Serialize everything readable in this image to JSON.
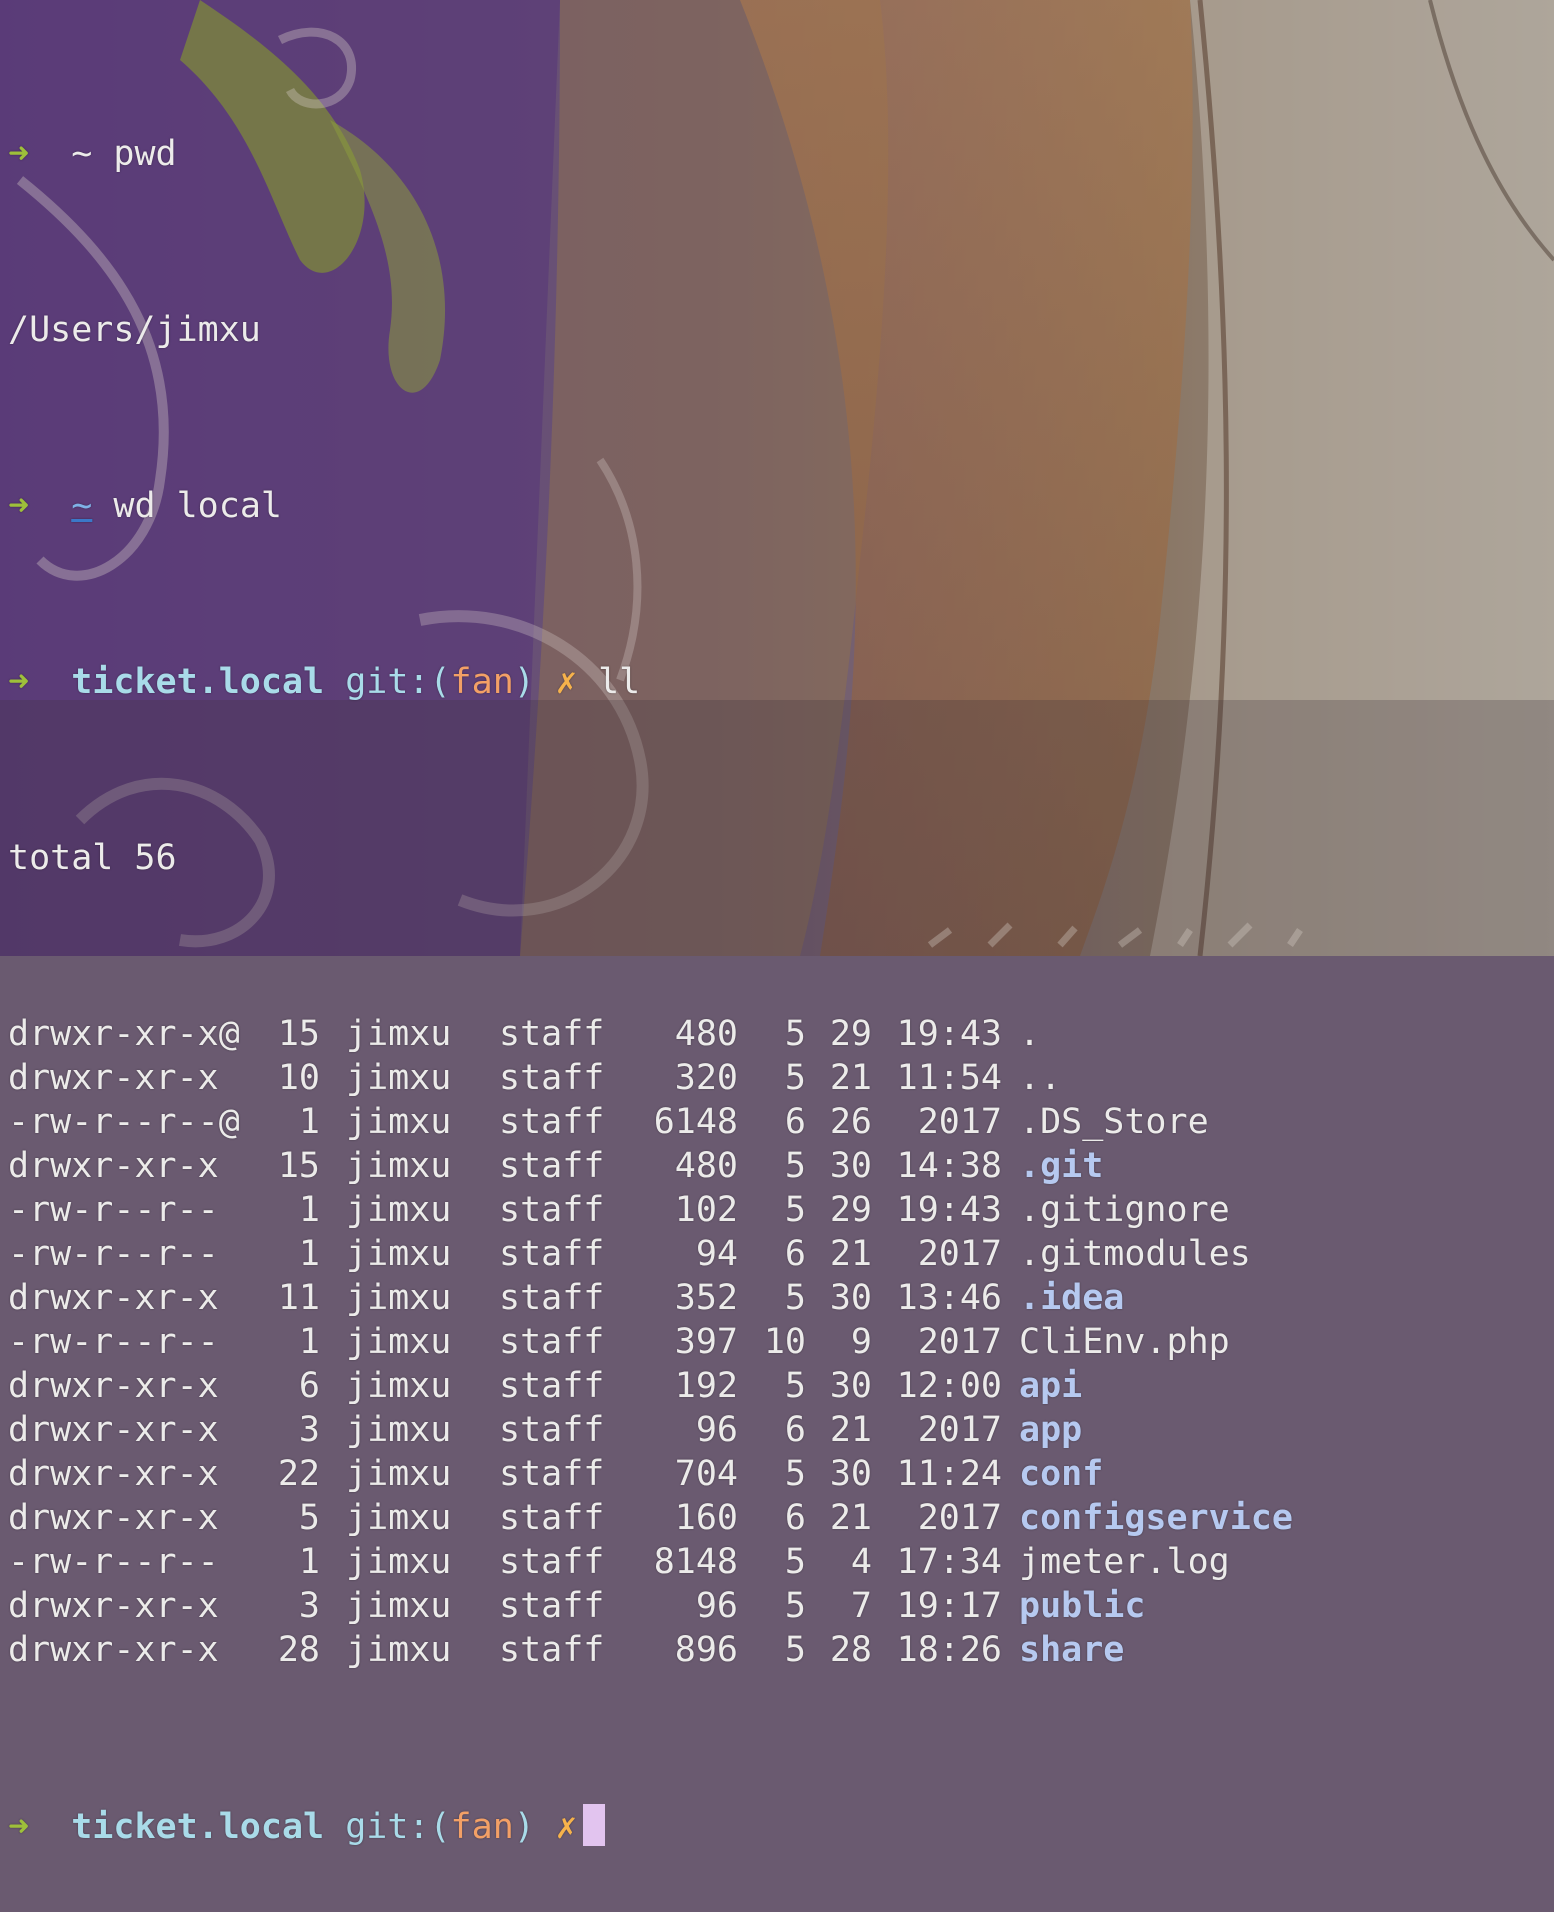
{
  "terminal": {
    "prompt_symbol": "➜",
    "lines": {
      "l1": {
        "dir": "~",
        "command": "pwd"
      },
      "l2": {
        "output": "/Users/jimxu"
      },
      "l3": {
        "dir": "~",
        "command": "wd local"
      },
      "l4": {
        "dir": "ticket.local",
        "git_prefix": "git:(",
        "branch": "fan",
        "git_suffix": ")",
        "dirty": "✗",
        "command": "ll"
      },
      "l5": {
        "output": "total 56"
      }
    },
    "listing": [
      {
        "perm": "drwxr-xr-x@",
        "links": "15",
        "owner": "jimxu",
        "group": "staff",
        "size": "480",
        "month": "5",
        "day": "29",
        "time": "19:43",
        "name": ".",
        "is_dir": false
      },
      {
        "perm": "drwxr-xr-x",
        "links": "10",
        "owner": "jimxu",
        "group": "staff",
        "size": "320",
        "month": "5",
        "day": "21",
        "time": "11:54",
        "name": "..",
        "is_dir": false
      },
      {
        "perm": "-rw-r--r--@",
        "links": "1",
        "owner": "jimxu",
        "group": "staff",
        "size": "6148",
        "month": "6",
        "day": "26",
        "time": "2017",
        "name": ".DS_Store",
        "is_dir": false
      },
      {
        "perm": "drwxr-xr-x",
        "links": "15",
        "owner": "jimxu",
        "group": "staff",
        "size": "480",
        "month": "5",
        "day": "30",
        "time": "14:38",
        "name": ".git",
        "is_dir": true
      },
      {
        "perm": "-rw-r--r--",
        "links": "1",
        "owner": "jimxu",
        "group": "staff",
        "size": "102",
        "month": "5",
        "day": "29",
        "time": "19:43",
        "name": ".gitignore",
        "is_dir": false
      },
      {
        "perm": "-rw-r--r--",
        "links": "1",
        "owner": "jimxu",
        "group": "staff",
        "size": "94",
        "month": "6",
        "day": "21",
        "time": "2017",
        "name": ".gitmodules",
        "is_dir": false
      },
      {
        "perm": "drwxr-xr-x",
        "links": "11",
        "owner": "jimxu",
        "group": "staff",
        "size": "352",
        "month": "5",
        "day": "30",
        "time": "13:46",
        "name": ".idea",
        "is_dir": true
      },
      {
        "perm": "-rw-r--r--",
        "links": "1",
        "owner": "jimxu",
        "group": "staff",
        "size": "397",
        "month": "10",
        "day": "9",
        "time": "2017",
        "name": "CliEnv.php",
        "is_dir": false
      },
      {
        "perm": "drwxr-xr-x",
        "links": "6",
        "owner": "jimxu",
        "group": "staff",
        "size": "192",
        "month": "5",
        "day": "30",
        "time": "12:00",
        "name": "api",
        "is_dir": true
      },
      {
        "perm": "drwxr-xr-x",
        "links": "3",
        "owner": "jimxu",
        "group": "staff",
        "size": "96",
        "month": "6",
        "day": "21",
        "time": "2017",
        "name": "app",
        "is_dir": true
      },
      {
        "perm": "drwxr-xr-x",
        "links": "22",
        "owner": "jimxu",
        "group": "staff",
        "size": "704",
        "month": "5",
        "day": "30",
        "time": "11:24",
        "name": "conf",
        "is_dir": true
      },
      {
        "perm": "drwxr-xr-x",
        "links": "5",
        "owner": "jimxu",
        "group": "staff",
        "size": "160",
        "month": "6",
        "day": "21",
        "time": "2017",
        "name": "configservice",
        "is_dir": true
      },
      {
        "perm": "-rw-r--r--",
        "links": "1",
        "owner": "jimxu",
        "group": "staff",
        "size": "8148",
        "month": "5",
        "day": "4",
        "time": "17:34",
        "name": "jmeter.log",
        "is_dir": false
      },
      {
        "perm": "drwxr-xr-x",
        "links": "3",
        "owner": "jimxu",
        "group": "staff",
        "size": "96",
        "month": "5",
        "day": "7",
        "time": "19:17",
        "name": "public",
        "is_dir": true
      },
      {
        "perm": "drwxr-xr-x",
        "links": "28",
        "owner": "jimxu",
        "group": "staff",
        "size": "896",
        "month": "5",
        "day": "28",
        "time": "18:26",
        "name": "share",
        "is_dir": true
      }
    ],
    "final_prompt": {
      "dir": "ticket.local",
      "git_prefix": "git:(",
      "branch": "fan",
      "git_suffix": ")",
      "dirty": "✗"
    }
  },
  "colors": {
    "arrow": "#9ec03a",
    "dir_prompt": "#a9dbe9",
    "branch": "#f3a066",
    "dirty": "#f6b24b",
    "directory_entry": "#b6c9f0",
    "cursor": "#e2c4ef"
  },
  "icons": {
    "cursor": "block-cursor-icon",
    "prompt": "arrow-right-icon"
  }
}
